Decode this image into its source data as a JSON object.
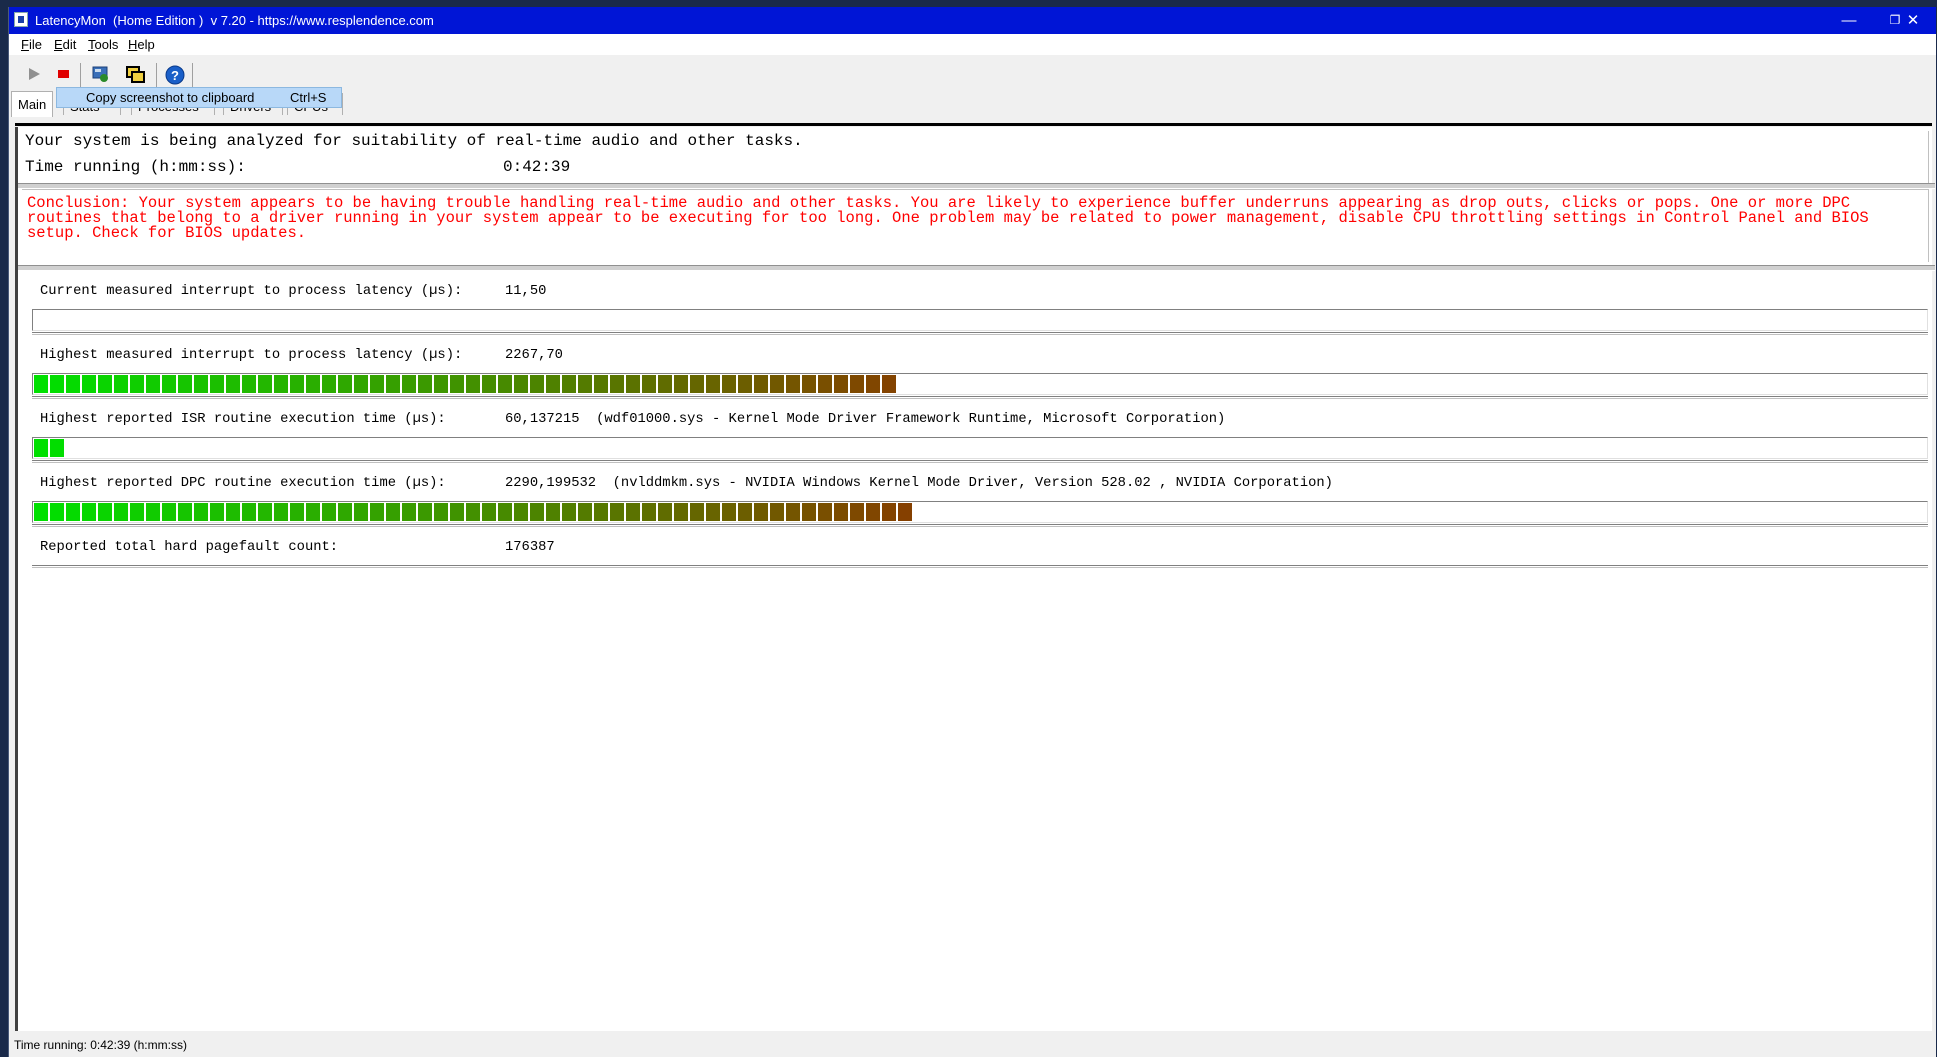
{
  "window": {
    "title": "LatencyMon  (Home Edition )  v 7.20 - https://www.resplendence.com",
    "controls": {
      "minimize": "—",
      "restore": "❐",
      "close": "✕"
    }
  },
  "menu": {
    "file": {
      "ul": "F",
      "rest": "ile"
    },
    "edit": {
      "ul": "E",
      "rest": "dit"
    },
    "tools": {
      "ul": "T",
      "rest": "ools"
    },
    "help": {
      "ul": "H",
      "rest": "elp"
    }
  },
  "toolbar": {
    "icons": [
      "play-icon",
      "stop-icon",
      "screenshot-icon",
      "copy-windows-icon",
      "help-icon"
    ]
  },
  "tabs": {
    "main": "Main",
    "stats": "Stats",
    "processes": "Processes",
    "drivers": "Drivers",
    "cpus": "CPUs"
  },
  "context_menu": {
    "item_label": "Copy screenshot to clipboard",
    "item_shortcut": "Ctrl+S"
  },
  "summary": {
    "analyzing": "Your system is being analyzed for suitability of real-time audio and other tasks.",
    "time_running_label": "Time running (h:mm:ss):",
    "time_running_value": "0:42:39"
  },
  "conclusion": "Conclusion: Your system appears to be having trouble handling real-time audio and other tasks. You are likely to experience buffer underruns appearing as drop outs, clicks or pops. One or more DPC routines that belong to a driver running in your system appear to be executing for too long. One problem may be related to power management, disable CPU throttling settings in Control Panel and BIOS setup. Check for BIOS updates.",
  "metrics": {
    "current_latency_label": "Current measured interrupt to process latency (µs):",
    "current_latency_value": "11,50",
    "current_latency_segments": 0,
    "highest_latency_label": "Highest measured interrupt to process latency (µs):",
    "highest_latency_value": "2267,70",
    "highest_latency_segments": 54,
    "isr_label": "Highest reported ISR routine execution time (µs):",
    "isr_value": "60,137215  (wdf01000.sys - Kernel Mode Driver Framework Runtime, Microsoft Corporation)",
    "isr_segments": 2,
    "dpc_label": "Highest reported DPC routine execution time (µs):",
    "dpc_value": "2290,199532  (nvlddmkm.sys - NVIDIA Windows Kernel Mode Driver, Version 528.02 , NVIDIA Corporation)",
    "dpc_segments": 55,
    "pagefault_label": "Reported total hard pagefault count:",
    "pagefault_value": "176387"
  },
  "colors": {
    "title_bar": "#0015d6",
    "conclusion_text": "#ff0000",
    "bar_start": "#00e000",
    "bar_end": "#8a3a00"
  },
  "status_bar": "Time running: 0:42:39  (h:mm:ss)"
}
